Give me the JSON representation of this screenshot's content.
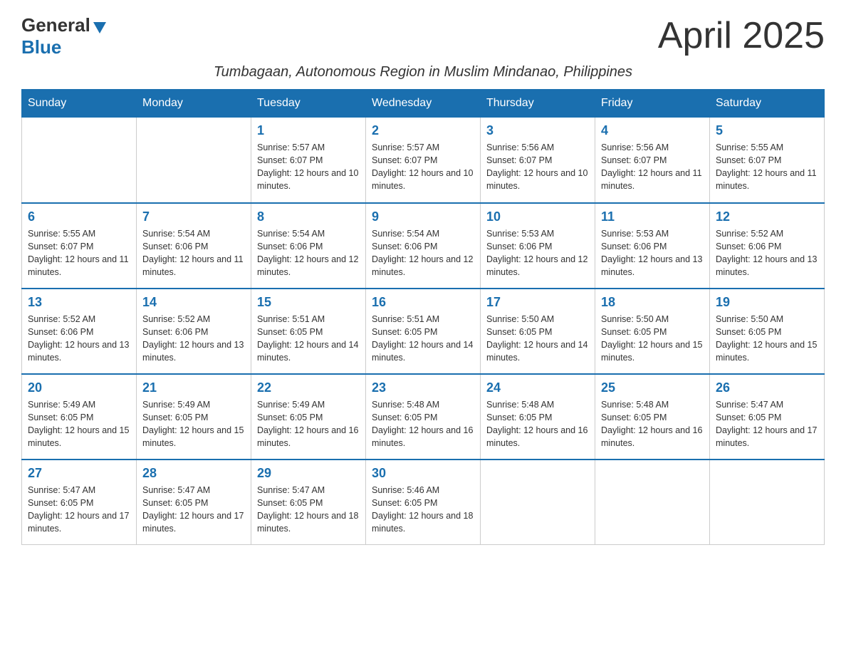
{
  "header": {
    "logo_general": "General",
    "logo_blue": "Blue",
    "month_title": "April 2025",
    "subtitle": "Tumbagaan, Autonomous Region in Muslim Mindanao, Philippines"
  },
  "days_of_week": [
    "Sunday",
    "Monday",
    "Tuesday",
    "Wednesday",
    "Thursday",
    "Friday",
    "Saturday"
  ],
  "weeks": [
    [
      {
        "day": "",
        "sunrise": "",
        "sunset": "",
        "daylight": ""
      },
      {
        "day": "",
        "sunrise": "",
        "sunset": "",
        "daylight": ""
      },
      {
        "day": "1",
        "sunrise": "Sunrise: 5:57 AM",
        "sunset": "Sunset: 6:07 PM",
        "daylight": "Daylight: 12 hours and 10 minutes."
      },
      {
        "day": "2",
        "sunrise": "Sunrise: 5:57 AM",
        "sunset": "Sunset: 6:07 PM",
        "daylight": "Daylight: 12 hours and 10 minutes."
      },
      {
        "day": "3",
        "sunrise": "Sunrise: 5:56 AM",
        "sunset": "Sunset: 6:07 PM",
        "daylight": "Daylight: 12 hours and 10 minutes."
      },
      {
        "day": "4",
        "sunrise": "Sunrise: 5:56 AM",
        "sunset": "Sunset: 6:07 PM",
        "daylight": "Daylight: 12 hours and 11 minutes."
      },
      {
        "day": "5",
        "sunrise": "Sunrise: 5:55 AM",
        "sunset": "Sunset: 6:07 PM",
        "daylight": "Daylight: 12 hours and 11 minutes."
      }
    ],
    [
      {
        "day": "6",
        "sunrise": "Sunrise: 5:55 AM",
        "sunset": "Sunset: 6:07 PM",
        "daylight": "Daylight: 12 hours and 11 minutes."
      },
      {
        "day": "7",
        "sunrise": "Sunrise: 5:54 AM",
        "sunset": "Sunset: 6:06 PM",
        "daylight": "Daylight: 12 hours and 11 minutes."
      },
      {
        "day": "8",
        "sunrise": "Sunrise: 5:54 AM",
        "sunset": "Sunset: 6:06 PM",
        "daylight": "Daylight: 12 hours and 12 minutes."
      },
      {
        "day": "9",
        "sunrise": "Sunrise: 5:54 AM",
        "sunset": "Sunset: 6:06 PM",
        "daylight": "Daylight: 12 hours and 12 minutes."
      },
      {
        "day": "10",
        "sunrise": "Sunrise: 5:53 AM",
        "sunset": "Sunset: 6:06 PM",
        "daylight": "Daylight: 12 hours and 12 minutes."
      },
      {
        "day": "11",
        "sunrise": "Sunrise: 5:53 AM",
        "sunset": "Sunset: 6:06 PM",
        "daylight": "Daylight: 12 hours and 13 minutes."
      },
      {
        "day": "12",
        "sunrise": "Sunrise: 5:52 AM",
        "sunset": "Sunset: 6:06 PM",
        "daylight": "Daylight: 12 hours and 13 minutes."
      }
    ],
    [
      {
        "day": "13",
        "sunrise": "Sunrise: 5:52 AM",
        "sunset": "Sunset: 6:06 PM",
        "daylight": "Daylight: 12 hours and 13 minutes."
      },
      {
        "day": "14",
        "sunrise": "Sunrise: 5:52 AM",
        "sunset": "Sunset: 6:06 PM",
        "daylight": "Daylight: 12 hours and 13 minutes."
      },
      {
        "day": "15",
        "sunrise": "Sunrise: 5:51 AM",
        "sunset": "Sunset: 6:05 PM",
        "daylight": "Daylight: 12 hours and 14 minutes."
      },
      {
        "day": "16",
        "sunrise": "Sunrise: 5:51 AM",
        "sunset": "Sunset: 6:05 PM",
        "daylight": "Daylight: 12 hours and 14 minutes."
      },
      {
        "day": "17",
        "sunrise": "Sunrise: 5:50 AM",
        "sunset": "Sunset: 6:05 PM",
        "daylight": "Daylight: 12 hours and 14 minutes."
      },
      {
        "day": "18",
        "sunrise": "Sunrise: 5:50 AM",
        "sunset": "Sunset: 6:05 PM",
        "daylight": "Daylight: 12 hours and 15 minutes."
      },
      {
        "day": "19",
        "sunrise": "Sunrise: 5:50 AM",
        "sunset": "Sunset: 6:05 PM",
        "daylight": "Daylight: 12 hours and 15 minutes."
      }
    ],
    [
      {
        "day": "20",
        "sunrise": "Sunrise: 5:49 AM",
        "sunset": "Sunset: 6:05 PM",
        "daylight": "Daylight: 12 hours and 15 minutes."
      },
      {
        "day": "21",
        "sunrise": "Sunrise: 5:49 AM",
        "sunset": "Sunset: 6:05 PM",
        "daylight": "Daylight: 12 hours and 15 minutes."
      },
      {
        "day": "22",
        "sunrise": "Sunrise: 5:49 AM",
        "sunset": "Sunset: 6:05 PM",
        "daylight": "Daylight: 12 hours and 16 minutes."
      },
      {
        "day": "23",
        "sunrise": "Sunrise: 5:48 AM",
        "sunset": "Sunset: 6:05 PM",
        "daylight": "Daylight: 12 hours and 16 minutes."
      },
      {
        "day": "24",
        "sunrise": "Sunrise: 5:48 AM",
        "sunset": "Sunset: 6:05 PM",
        "daylight": "Daylight: 12 hours and 16 minutes."
      },
      {
        "day": "25",
        "sunrise": "Sunrise: 5:48 AM",
        "sunset": "Sunset: 6:05 PM",
        "daylight": "Daylight: 12 hours and 16 minutes."
      },
      {
        "day": "26",
        "sunrise": "Sunrise: 5:47 AM",
        "sunset": "Sunset: 6:05 PM",
        "daylight": "Daylight: 12 hours and 17 minutes."
      }
    ],
    [
      {
        "day": "27",
        "sunrise": "Sunrise: 5:47 AM",
        "sunset": "Sunset: 6:05 PM",
        "daylight": "Daylight: 12 hours and 17 minutes."
      },
      {
        "day": "28",
        "sunrise": "Sunrise: 5:47 AM",
        "sunset": "Sunset: 6:05 PM",
        "daylight": "Daylight: 12 hours and 17 minutes."
      },
      {
        "day": "29",
        "sunrise": "Sunrise: 5:47 AM",
        "sunset": "Sunset: 6:05 PM",
        "daylight": "Daylight: 12 hours and 18 minutes."
      },
      {
        "day": "30",
        "sunrise": "Sunrise: 5:46 AM",
        "sunset": "Sunset: 6:05 PM",
        "daylight": "Daylight: 12 hours and 18 minutes."
      },
      {
        "day": "",
        "sunrise": "",
        "sunset": "",
        "daylight": ""
      },
      {
        "day": "",
        "sunrise": "",
        "sunset": "",
        "daylight": ""
      },
      {
        "day": "",
        "sunrise": "",
        "sunset": "",
        "daylight": ""
      }
    ]
  ]
}
